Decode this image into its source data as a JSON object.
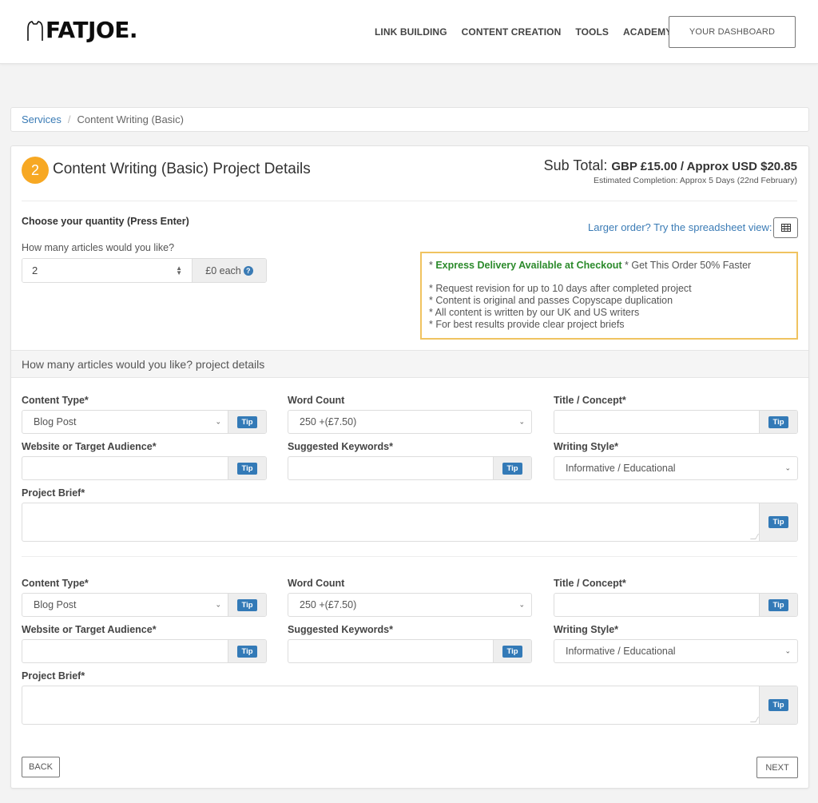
{
  "header": {
    "logo_text": "FATJOE.",
    "nav": [
      {
        "label": "LINK BUILDING"
      },
      {
        "label": "CONTENT CREATION"
      },
      {
        "label": "TOOLS"
      },
      {
        "label": "ACADEMY"
      }
    ],
    "dashboard_button": "YOUR DASHBOARD"
  },
  "breadcrumb": {
    "items": [
      {
        "label": "Services",
        "link": true
      },
      {
        "label": "Content Writing (Basic)",
        "link": false
      }
    ],
    "separator": "/"
  },
  "panel": {
    "step_number": "2",
    "title": "Content Writing (Basic) Project Details",
    "subtotal_label": "Sub Total:",
    "subtotal_value": "GBP £15.00 / Approx USD $20.85",
    "estimated_completion": "Estimated Completion: Approx 5 Days (22nd February)",
    "quantity_title": "Choose your quantity (Press Enter)",
    "quantity_label": "How many articles would you like?",
    "quantity_value": "2",
    "price_each": "£0 each",
    "help_icon": "?",
    "spreadsheet_link": "Larger order? Try the spreadsheet view:",
    "spreadsheet_icon": "table-grid-icon",
    "info": {
      "express_prefix": "* ",
      "express_highlight": "Express Delivery Available at Checkout",
      "express_suffix": " * Get This Order 50% Faster",
      "bullets": [
        "* Request revision for up to 10 days after completed project",
        "* Content is original and passes Copyscape duplication",
        "* All content is written by our UK and US writers",
        "* For best results provide clear project briefs"
      ]
    },
    "section_title": "How many articles would you like? project details",
    "tip_label": "Tip",
    "articles": [
      {
        "content_type_label": "Content Type*",
        "content_type_value": "Blog Post",
        "word_count_label": "Word Count",
        "word_count_value": "250 +(£7.50)",
        "title_label": "Title / Concept*",
        "title_value": "",
        "audience_label": "Website or Target Audience*",
        "audience_value": "",
        "keywords_label": "Suggested Keywords*",
        "keywords_value": "",
        "style_label": "Writing Style*",
        "style_value": "Informative / Educational",
        "brief_label": "Project Brief*",
        "brief_value": ""
      },
      {
        "content_type_label": "Content Type*",
        "content_type_value": "Blog Post",
        "word_count_label": "Word Count",
        "word_count_value": "250 +(£7.50)",
        "title_label": "Title / Concept*",
        "title_value": "",
        "audience_label": "Website or Target Audience*",
        "audience_value": "",
        "keywords_label": "Suggested Keywords*",
        "keywords_value": "",
        "style_label": "Writing Style*",
        "style_value": "Informative / Educational",
        "brief_label": "Project Brief*",
        "brief_value": ""
      }
    ],
    "back_button": "BACK",
    "next_button": "NEXT"
  },
  "colors": {
    "accent_orange": "#f7a823",
    "link_blue": "#3a7bb5",
    "tip_blue": "#337ab7",
    "express_green": "#2b8a2b",
    "info_border": "#f0c360"
  }
}
